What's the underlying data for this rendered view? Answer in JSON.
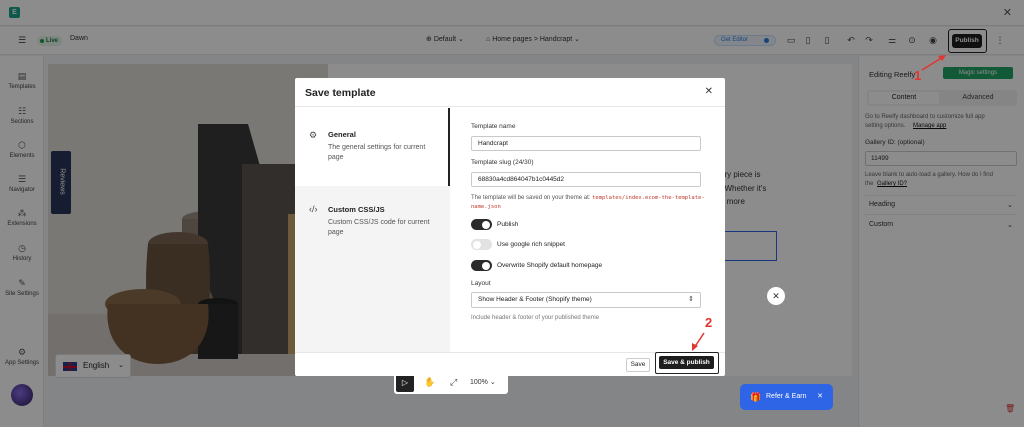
{
  "window": {
    "close_icon": "close-icon"
  },
  "header": {
    "live": "Live",
    "theme_name": "Dawn",
    "template_selector": "Default",
    "breadcrumb": "Home pages > Handcrapt",
    "get_editor": "Get Editor",
    "publish": "Publish"
  },
  "sidebar": {
    "items": [
      {
        "label": "Templates",
        "icon": "templates-icon"
      },
      {
        "label": "Sections",
        "icon": "sections-icon"
      },
      {
        "label": "Elements",
        "icon": "elements-icon"
      },
      {
        "label": "Navigator",
        "icon": "navigator-icon"
      },
      {
        "label": "Extensions",
        "icon": "extensions-icon"
      },
      {
        "label": "History",
        "icon": "history-icon"
      },
      {
        "label": "Site Settings",
        "icon": "site-settings-icon"
      },
      {
        "label": "App Settings",
        "icon": "app-settings-icon"
      }
    ]
  },
  "canvas": {
    "reviews_tab": "Reviews",
    "language": "English",
    "text_fragments": [
      "ery piece is",
      ". Whether it's",
      "a more"
    ],
    "zoom": "100%",
    "refer_earn": "Refer & Earn"
  },
  "right_panel": {
    "title": "Editing Reelfy",
    "magic_settings": "Magic settings",
    "tab_content": "Content",
    "tab_advanced": "Advanced",
    "info_line1": "Go to Reelfy dashboard to customize full app",
    "info_line2": "setting options.",
    "manage_app": "Manage app",
    "gallery_id_label": "Gallery ID: (optional)",
    "gallery_id_value": "11499",
    "gallery_help1": "Leave blank to auto-load a gallery. How do I find",
    "gallery_help2": "the",
    "gallery_help_link": "Gallery ID?",
    "heading": "Heading",
    "custom": "Custom"
  },
  "modal": {
    "title": "Save template",
    "general_title": "General",
    "general_desc": "The general settings for current page",
    "custom_title": "Custom CSS/JS",
    "custom_desc": "Custom CSS/JS code for current page",
    "template_name_label": "Template name",
    "template_name_value": "Handcrapt",
    "template_slug_label": "Template slug (24/30)",
    "template_slug_value": "68830a4cd864047b1c0445d2",
    "slug_note": "The template will be saved on your theme at:",
    "slug_path": "templates/index.ecom-the-template-name.json",
    "toggles": [
      {
        "label": "Publish",
        "on": true
      },
      {
        "label": "Use google rich snippet",
        "on": false
      },
      {
        "label": "Overwrite Shopify default homepage",
        "on": true
      }
    ],
    "layout_label": "Layout",
    "layout_value": "Show Header & Footer (Shopify theme)",
    "layout_help": "Include header & footer of your published theme",
    "save": "Save",
    "save_publish": "Save & publish"
  },
  "annotations": {
    "step1": "1",
    "step2": "2"
  },
  "colors": {
    "accent": "#e3342f",
    "live": "#1f9d4a",
    "magic": "#21a366",
    "refer": "#2e64e6"
  }
}
